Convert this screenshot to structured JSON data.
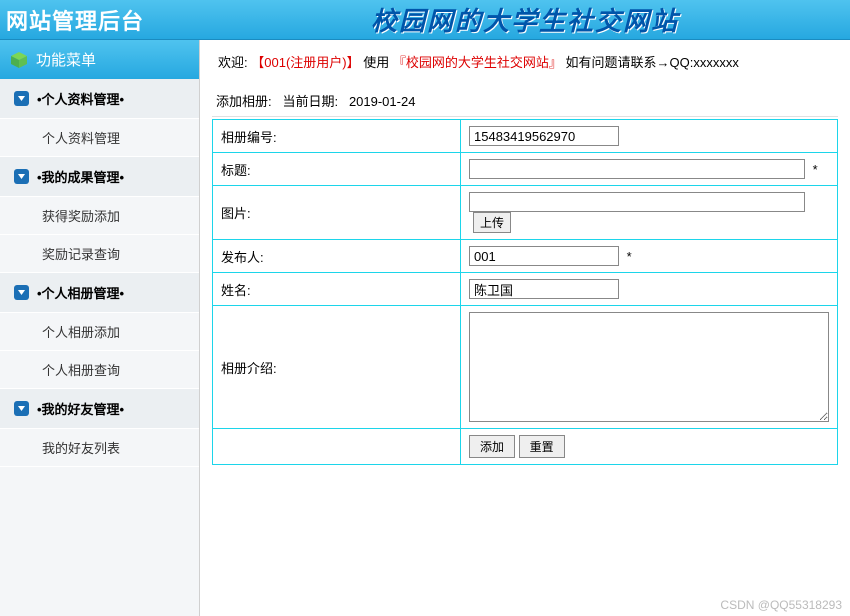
{
  "header": {
    "left": "网站管理后台",
    "title": "校园网的大学生社交网站"
  },
  "sidebar": {
    "title": "功能菜单",
    "groups": [
      {
        "label": "•个人资料管理•",
        "items": [
          "个人资料管理"
        ]
      },
      {
        "label": "•我的成果管理•",
        "items": [
          "获得奖励添加",
          "奖励记录查询"
        ]
      },
      {
        "label": "•个人相册管理•",
        "items": [
          "个人相册添加",
          "个人相册查询"
        ]
      },
      {
        "label": "•我的好友管理•",
        "items": [
          "我的好友列表"
        ]
      }
    ]
  },
  "welcome": {
    "prefix": "欢迎:",
    "user": "【001(注册用户)】",
    "mid": "使用",
    "site": "『校园网的大学生社交网站』",
    "suffix": "如有问题请联系→QQ:xxxxxxx"
  },
  "breadcrumb": {
    "page": "添加相册:",
    "date_label": "当前日期:",
    "date_value": "2019-01-24"
  },
  "form": {
    "album_id_label": "相册编号:",
    "album_id_value": "15483419562970",
    "title_label": "标题:",
    "title_value": "",
    "image_label": "图片:",
    "image_value": "",
    "upload_btn": "上传",
    "publisher_label": "发布人:",
    "publisher_value": "001",
    "name_label": "姓名:",
    "name_value": "陈卫国",
    "intro_label": "相册介绍:",
    "intro_value": "",
    "required_mark": "*",
    "submit_btn": "添加",
    "reset_btn": "重置"
  },
  "watermark": "CSDN @QQ55318293"
}
